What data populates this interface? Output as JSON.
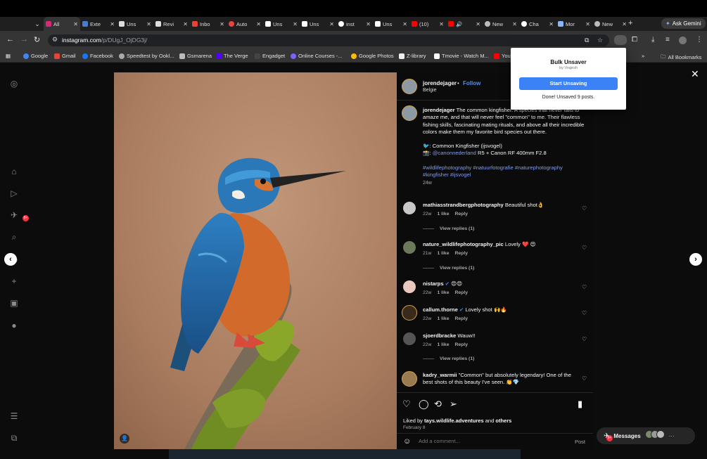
{
  "browser": {
    "tabs": [
      {
        "label": "All"
      },
      {
        "label": "Exte"
      },
      {
        "label": "Uns"
      },
      {
        "label": "Revi"
      },
      {
        "label": "Inbo"
      },
      {
        "label": "Auto"
      },
      {
        "label": "Uns"
      },
      {
        "label": "Uns"
      },
      {
        "label": "inst"
      },
      {
        "label": "Uns"
      },
      {
        "label": "(10)"
      },
      {
        "label": ""
      },
      {
        "label": "New"
      },
      {
        "label": "Cha"
      },
      {
        "label": "Mor"
      },
      {
        "label": "New"
      }
    ],
    "ask_gemini": "Ask Gemini",
    "url_host": "instagram.com",
    "url_path": "/p/DUgJ_OjDG3j/",
    "bookmarks": [
      "Google",
      "Gmail",
      "Facebook",
      "Speedtest by Ookl...",
      "Gsmarena",
      "The Verge",
      "Engadget",
      "Online Courses -...",
      "Google Photos",
      "Z-library",
      "Tmovie - Watch M...",
      "You"
    ],
    "bookmarks_overflow": "»",
    "all_bookmarks": "All Bookmarks"
  },
  "popup": {
    "title": "Bulk Unsaver",
    "subtitle": "by Vrajesh",
    "button": "Start Unsaving",
    "status": "Done! Unsaved 9 posts."
  },
  "post": {
    "author": "jorendejager",
    "follow": "Follow",
    "separator": "•",
    "location": "Belgie",
    "caption_text": "The common kingfisher. A species that never fails to amaze me, and that will never feel \"common\" to me. Their flawless fishing skills, fascinating mating rituals, and above all their incredible colors make them my favorite bird species out there.",
    "species_line": "🐦: Common Kingfisher (ijsvogel)",
    "gear_prefix": "📸:",
    "gear_mention": "@canonnederland",
    "gear_rest": "R5 + Canon RF 400mm F2.8",
    "hashtags": "#wildlifephotography #natuurfotografie #naturephotography #kingfisher #ijsvogel",
    "caption_age": "24w",
    "comments": [
      {
        "user": "mathiasstrandbergphotography",
        "text": "Beautiful shot👌",
        "age": "22w",
        "likes": "1 like",
        "reply": "Reply",
        "view_replies": "View replies (1)"
      },
      {
        "user": "nature_wildlifephotography_pic",
        "text": "Lovely ❤️ 😍",
        "age": "21w",
        "likes": "1 like",
        "reply": "Reply",
        "view_replies": "View replies (1)"
      },
      {
        "user": "nistarps",
        "text": "😍😍",
        "age": "22w",
        "likes": "1 like",
        "reply": "Reply"
      },
      {
        "user": "callum.thorne",
        "text": "Lovely shot 🙌🔥",
        "age": "22w",
        "likes": "1 like",
        "reply": "Reply"
      },
      {
        "user": "sjoerdbracke",
        "text": "Wauw!!",
        "age": "22w",
        "likes": "1 like",
        "reply": "Reply",
        "view_replies": "View replies (1)"
      },
      {
        "user": "kadry_warmii",
        "text": "\"Common\" but absolutely legendary! One of the best shots of this beauty I've seen. 👏💎"
      }
    ],
    "liked_by_prefix": "Liked by",
    "liked_by_user": "tays.wildlife.adventures",
    "liked_by_suffix": "and",
    "liked_by_others": "others",
    "date": "February 8",
    "comment_placeholder": "Add a comment...",
    "post_button": "Post"
  },
  "messages": {
    "label": "Messages"
  },
  "badges": {
    "sidebar_notifications": "9+",
    "messages": "9+"
  },
  "colors": {
    "accent_blue": "#0095f6",
    "popup_button": "#3b82f6",
    "link_blue": "#7f9df1"
  }
}
